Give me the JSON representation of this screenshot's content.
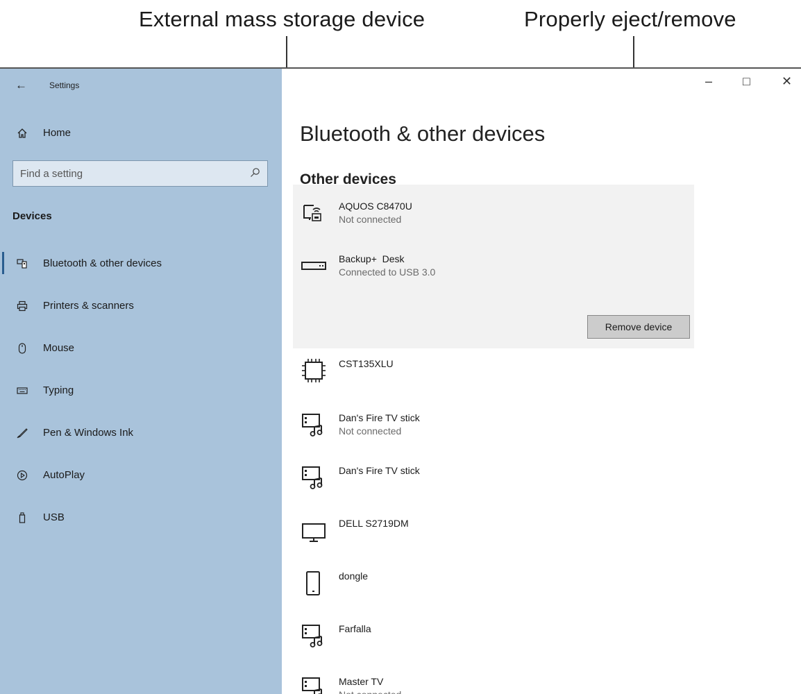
{
  "callouts": {
    "external_device": "External mass storage device",
    "eject": "Properly eject/remove"
  },
  "window": {
    "title": "Settings",
    "back_glyph": "←",
    "minimize_glyph": "–",
    "maximize_glyph": "□",
    "close_glyph": "✕"
  },
  "sidebar": {
    "home_label": "Home",
    "search_placeholder": "Find a setting",
    "section_label": "Devices",
    "items": [
      {
        "label": "Bluetooth & other devices",
        "icon": "bluetooth-devices-icon",
        "selected": true
      },
      {
        "label": "Printers & scanners",
        "icon": "printer-icon"
      },
      {
        "label": "Mouse",
        "icon": "mouse-icon"
      },
      {
        "label": "Typing",
        "icon": "keyboard-icon"
      },
      {
        "label": "Pen & Windows Ink",
        "icon": "pen-icon"
      },
      {
        "label": "AutoPlay",
        "icon": "autoplay-icon"
      },
      {
        "label": "USB",
        "icon": "usb-icon"
      }
    ]
  },
  "main": {
    "page_title": "Bluetooth & other devices",
    "section_title": "Other devices",
    "devices": [
      {
        "name": "AQUOS C8470U",
        "status": "Not connected",
        "icon": "wireless-display-icon"
      },
      {
        "name": "Backup+  Desk",
        "status": "Connected to USB 3.0",
        "icon": "drive-icon",
        "selected": true
      },
      {
        "name": "CST135XLU",
        "status": "",
        "icon": "chip-icon"
      },
      {
        "name": "Dan's Fire TV stick",
        "status": "Not connected",
        "icon": "media-device-icon"
      },
      {
        "name": "Dan's Fire TV stick",
        "status": "",
        "icon": "media-device-icon"
      },
      {
        "name": "DELL S2719DM",
        "status": "",
        "icon": "monitor-icon"
      },
      {
        "name": "dongle",
        "status": "",
        "icon": "phone-icon"
      },
      {
        "name": "Farfalla",
        "status": "",
        "icon": "media-device-icon"
      },
      {
        "name": "Master TV",
        "status": "Not connected",
        "icon": "media-device-icon"
      }
    ],
    "remove_button_label": "Remove device"
  },
  "colors": {
    "sidebar_bg": "#a9c3db",
    "selected_row_bg": "#f2f2f2",
    "button_bg": "#cccccc"
  }
}
